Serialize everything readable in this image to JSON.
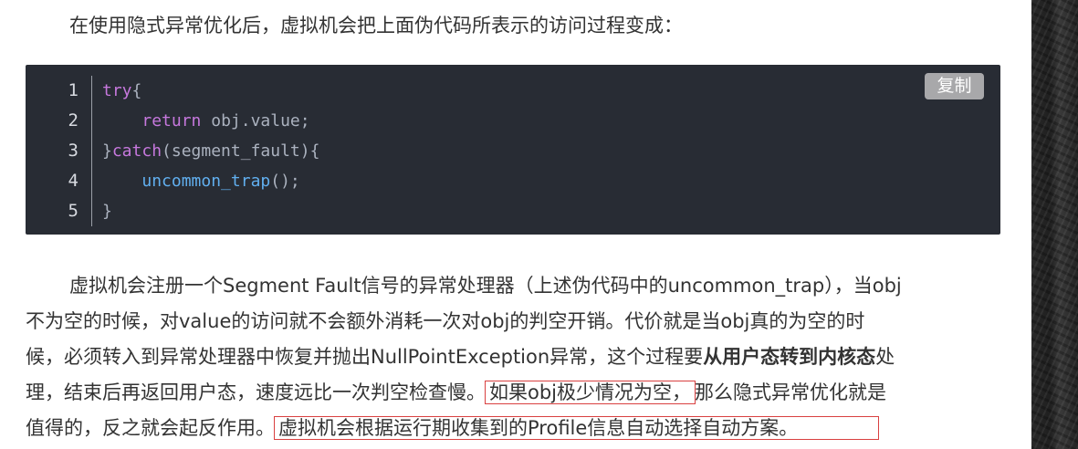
{
  "intro": "在使用隐式异常优化后，虚拟机会把上面伪代码所表示的访问过程变成：",
  "code": {
    "copy_label": "复制",
    "line_numbers": [
      "1",
      "2",
      "3",
      "4",
      "5"
    ],
    "lines": [
      {
        "t1": "",
        "k1": "try",
        "t2": "{",
        "f": "",
        "t3": ""
      },
      {
        "t1": "    ",
        "k1": "return",
        "t2": " obj.value;",
        "f": "",
        "t3": ""
      },
      {
        "t1": "}",
        "k1": "catch",
        "t2": "(segment_fault){",
        "f": "",
        "t3": ""
      },
      {
        "t1": "    ",
        "k1": "",
        "t2": "",
        "f": "uncommon_trap",
        "t3": "();"
      },
      {
        "t1": "}",
        "k1": "",
        "t2": "",
        "f": "",
        "t3": ""
      }
    ]
  },
  "paragraph": {
    "line1": "虚拟机会注册一个Segment Fault信号的异常处理器（上述伪代码中的uncommon_trap），当obj",
    "line2": "不为空的时候，对value的访问就不会额外消耗一次对obj的判空开销。代价就是当obj真的为空的时",
    "line3a": "候，必须转入到异常处理器中恢复并抛出NullPointException异常，这个过程要",
    "line3b": "从用户态转到内核态",
    "line3c": "处",
    "line4a": "理，结束后再返回用户态，速度远比一次判空检查慢。",
    "line4b": "如果obj极少情况为空，",
    "line4c": "那么隐式异常优化就是",
    "line5a": "值得的，反之就会起反作用。",
    "line5b": "虚拟机会根据运行期收集到的Profile信息自动选择自动方案。"
  }
}
